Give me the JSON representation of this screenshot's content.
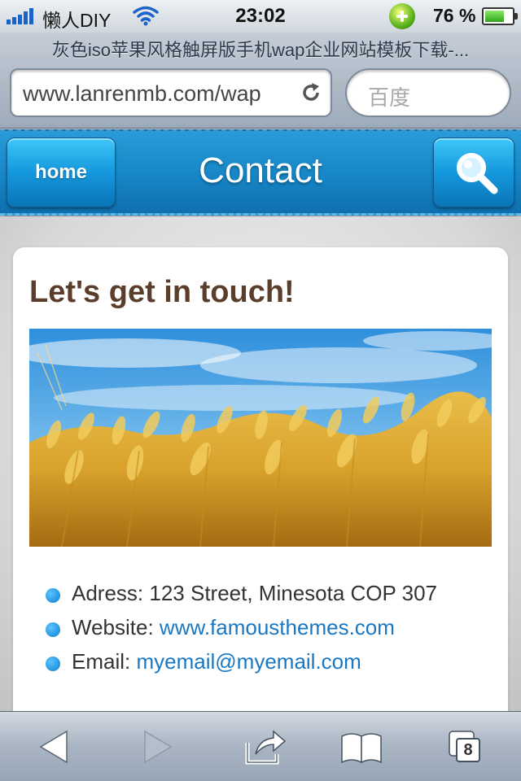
{
  "status_bar": {
    "carrier": "懒人DIY",
    "time": "23:02",
    "battery_percent": "76 %",
    "battery_level": 0.76
  },
  "browser": {
    "page_title": "灰色iso苹果风格触屏版手机wap企业网站模板下载-...",
    "url": "www.lanrenmb.com/wap",
    "search_placeholder": "百度"
  },
  "header": {
    "home_label": "home",
    "title": "Contact"
  },
  "contact": {
    "heading": "Let's get in touch!",
    "address_label": "Adress:",
    "address_value": "123 Street, Minesota COP 307",
    "website_label": "Website:",
    "website_link": "www.famousthemes.com",
    "email_label": "Email:",
    "email_link": "myemail@myemail.com"
  },
  "toolbar": {
    "tabs_count": "8"
  },
  "colors": {
    "header_blue": "#1686c6",
    "link_blue": "#1a78c2",
    "heading_brown": "#5a3e2b"
  }
}
